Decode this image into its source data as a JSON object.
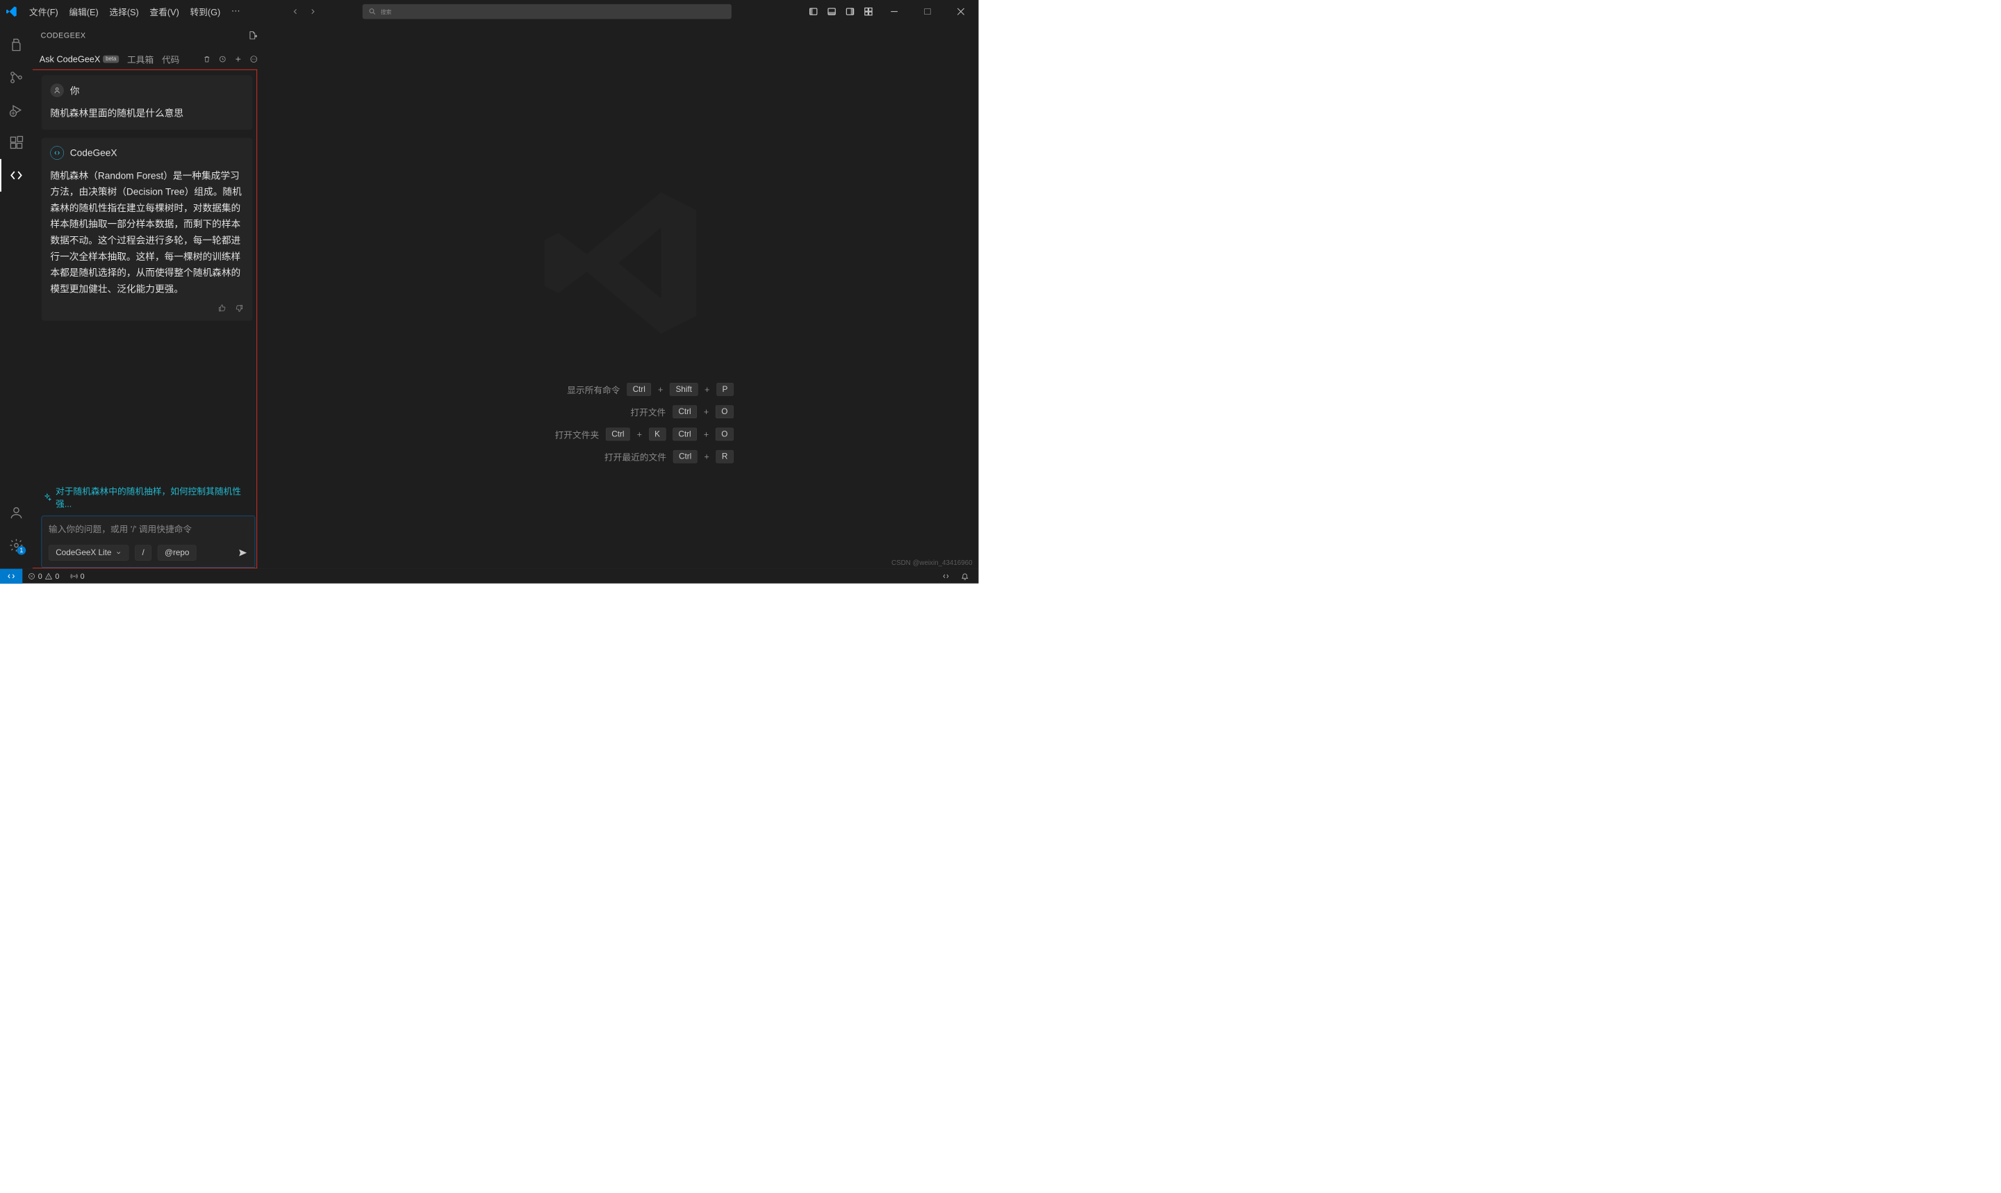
{
  "menu": {
    "file": "文件(F)",
    "edit": "编辑(E)",
    "select": "选择(S)",
    "view": "查看(V)",
    "go": "转到(G)"
  },
  "search_placeholder": "搜索",
  "panel": {
    "title": "CODEGEEX",
    "tabs": {
      "ask": "Ask CodeGeeX",
      "ask_tag": "beta",
      "tools": "工具箱",
      "code": "代码"
    }
  },
  "chat": {
    "user_name": "你",
    "user_msg": "随机森林里面的随机是什么意思",
    "bot_name": "CodeGeeX",
    "bot_msg": "随机森林（Random Forest）是一种集成学习方法，由决策树（Decision Tree）组成。随机森林的随机性指在建立每棵树时，对数据集的样本随机抽取一部分样本数据，而剩下的样本数据不动。这个过程会进行多轮，每一轮都进行一次全样本抽取。这样，每一棵树的训练样本都是随机选择的，从而使得整个随机森林的模型更加健壮、泛化能力更强。"
  },
  "suggest": "对于随机森林中的随机抽样，如何控制其随机性强...",
  "input_placeholder": "输入你的问题，或用 '/' 调用快捷命令",
  "chips": {
    "model": "CodeGeeX Lite",
    "slash": "/",
    "repo": "@repo"
  },
  "shortcuts": [
    {
      "label": "显示所有命令",
      "keys": [
        "Ctrl",
        "+",
        "Shift",
        "+",
        "P"
      ]
    },
    {
      "label": "打开文件",
      "keys": [
        "Ctrl",
        "+",
        "O"
      ]
    },
    {
      "label": "打开文件夹",
      "keys": [
        "Ctrl",
        "+",
        "K",
        "Ctrl",
        "+",
        "O"
      ]
    },
    {
      "label": "打开最近的文件",
      "keys": [
        "Ctrl",
        "+",
        "R"
      ]
    }
  ],
  "status": {
    "errors": "0",
    "warnings": "0",
    "ports": "0"
  },
  "settings_badge": "1",
  "watermark": "CSDN @weixin_43416960"
}
